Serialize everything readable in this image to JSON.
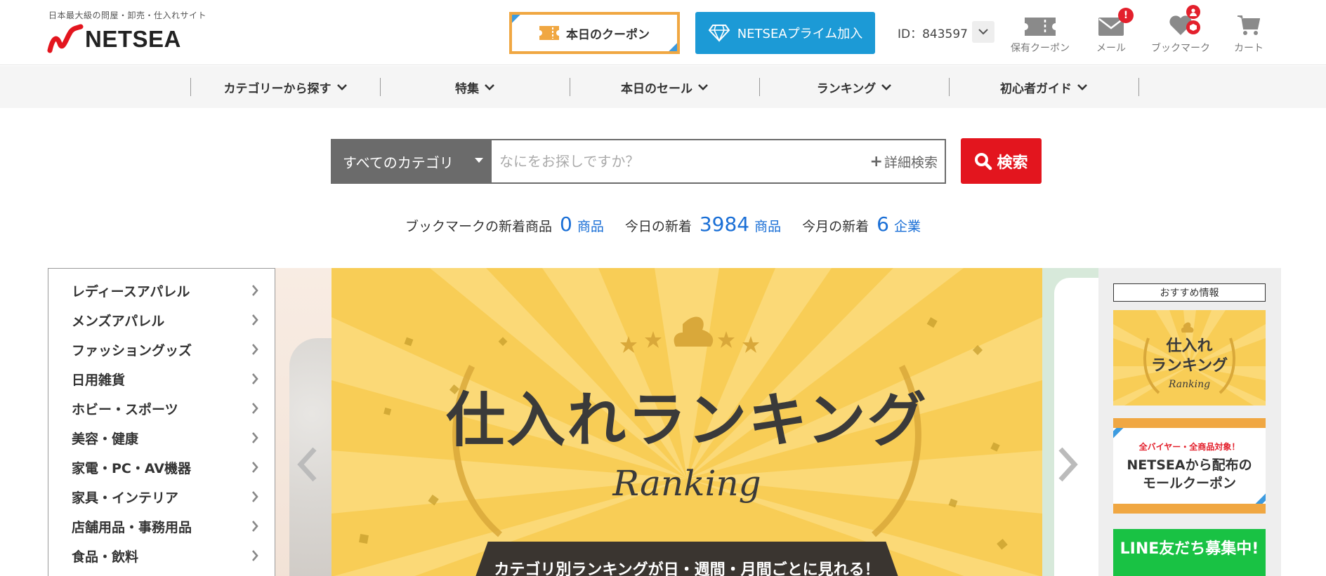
{
  "header": {
    "tagline": "日本最大級の問屋・卸売・仕入れサイト",
    "logo_text": "NETSEA",
    "coupon_button": "本日のクーポン",
    "prime_button": "NETSEAプライム加入",
    "user_id": "ID：843597",
    "icons": [
      {
        "name": "coupon-icon",
        "label": "保有クーポン",
        "badge": ""
      },
      {
        "name": "mail-icon",
        "label": "メール",
        "badge": "!"
      },
      {
        "name": "bookmark-icon",
        "label": "ブックマーク",
        "badge": ""
      },
      {
        "name": "cart-icon",
        "label": "カート",
        "badge": ""
      }
    ]
  },
  "nav": {
    "items": [
      "カテゴリーから探す",
      "特集",
      "本日のセール",
      "ランキング",
      "初心者ガイド"
    ]
  },
  "search": {
    "category": "すべてのカテゴリ",
    "placeholder": "なにをお探しですか？",
    "advanced": "詳細検索",
    "button": "検索"
  },
  "stats": [
    {
      "label": "ブックマークの新着商品",
      "value": "0",
      "unit": "商品"
    },
    {
      "label": "今日の新着",
      "value": "3984",
      "unit": "商品"
    },
    {
      "label": "今月の新着",
      "value": "6",
      "unit": "企業"
    }
  ],
  "categories": [
    "レディースアパレル",
    "メンズアパレル",
    "ファッショングッズ",
    "日用雑貨",
    "ホビー・スポーツ",
    "美容・健康",
    "家電・PC・AV機器",
    "家具・インテリア",
    "店舗用品・事務用品",
    "食品・飲料"
  ],
  "carousel": {
    "title": "仕入れランキング",
    "subtitle": "Ranking",
    "band": "カテゴリ別ランキングが日・週間・月間ごとに見れる！"
  },
  "sidebar": {
    "title": "おすすめ情報",
    "banner1": {
      "title": "仕入れ\nランキング",
      "subtitle": "Ranking"
    },
    "banner2": {
      "small": "全バイヤー・全商品対象！",
      "title": "NETSEAから配布の\nモールクーポン"
    },
    "banner3": {
      "title": "LINE友だち募集中!"
    }
  },
  "colors": {
    "accent_blue": "#1c9ad6",
    "search_red": "#e3151e",
    "coupon_orange": "#f0a742",
    "ranking_yellow": "#f8cd56",
    "link_blue": "#1a6fd6",
    "line_green": "#19c244"
  }
}
